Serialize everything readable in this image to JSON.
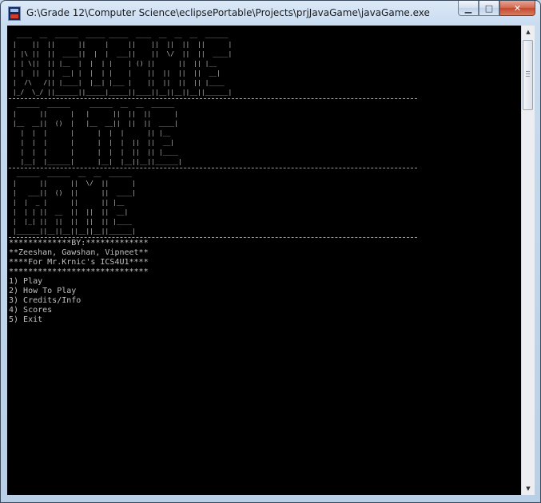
{
  "window": {
    "title": "G:\\Grade 12\\Computer Science\\eclipsePortable\\Projects\\prjJavaGame\\javaGame.exe",
    "icon": "console-app-icon",
    "controls": {
      "minimize": "▁",
      "maximize": "□",
      "close": "✕"
    }
  },
  "console": {
    "banner": {
      "welcome": "  ____  __  ______  _____ _____  ____  __  __  __  ______\n |    ||  ||      ||     |     ||    ||  ||  ||  ||      |\n | |\\ ||  ||  ____||  |  |  ___||    ||  \\/  ||  ||  ____|\n | | \\||  || |__  |  |  | |    | () ||      ||  || |__   \n | |  ||  ||  __| |  |  | |    |    ||  ||  ||  ||  __|  \n |  /\\   /|| |____|  |__| |___ |    ||  ||  ||  || |____ \n |_/  \\_/ ||______||_____|_____||____||__||__||__||______|",
      "to_the": "  ______  ______     ______  __  __  ______\n |      ||      |   |      ||  ||  ||      |\n |__  __||  ()  |   |__  __||  ||  ||  ____|\n   |  |  |      |      |  |  |      || |__   \n   |  |  |      |      |  |  |  ||  ||  __|  \n   |  |  |      |      |  |  |  ||  || |____ \n   |__|  |______|      |__|  |__||__||______|",
      "game": "  ______  ______  __  __  ______\n |      ||      ||  \\/  ||      |\n |   ___||  ()  ||      ||  ____|\n |  |  _ |      ||      || |__   \n |  | | ||  __  ||  ||  ||  __|  \n |  |_| ||  ||  ||  ||  || |____ \n |______||__||__||__||__||______|"
    },
    "credits": [
      "*************BY:*************",
      "**Zeeshan, Gawshan, Vipneet**",
      "****For Mr.Krnic's ICS4U1****",
      "*****************************"
    ],
    "menu": [
      "1) Play",
      "2) How To Play",
      "3) Credits/Info",
      "4) Scores",
      "5) Exit"
    ]
  },
  "scrollbar": {
    "up": "▲",
    "down": "▼"
  }
}
